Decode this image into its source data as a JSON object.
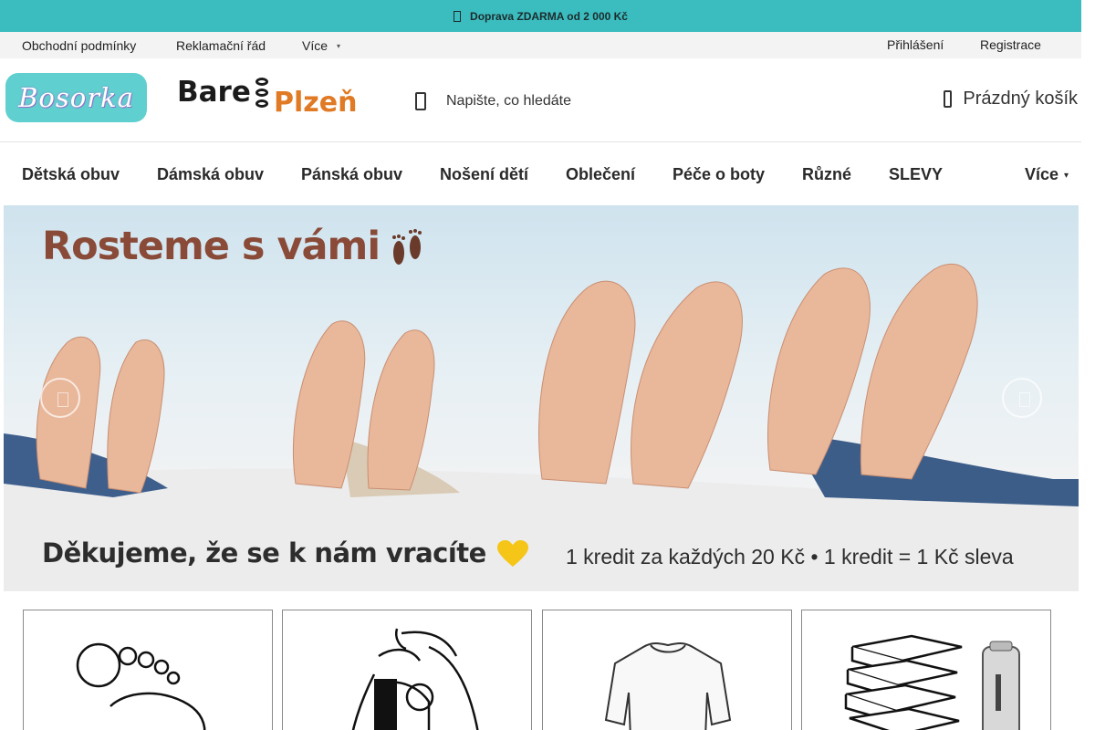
{
  "promo": {
    "text": "Doprava ZDARMA od 2 000 Kč",
    "icon": "truck-icon"
  },
  "top_nav": {
    "links": [
      "Obchodní podmínky",
      "Reklamační řád",
      "Více"
    ],
    "login": "Přihlášení",
    "register": "Registrace"
  },
  "header": {
    "logo_bosorka": "Bosorka",
    "logo_bare": "Bare",
    "logo_plzen": "Plzeň",
    "search_placeholder": "Napište, co hledáte",
    "cart_label": "Prázdný košík"
  },
  "main_nav": [
    "Dětská obuv",
    "Dámská obuv",
    "Pánská obuv",
    "Nošení dětí",
    "Oblečení",
    "Péče o boty",
    "Různé",
    "SLEVY",
    "Více"
  ],
  "hero": {
    "title": "Rosteme s vámi",
    "thanks": "Děkujeme, že se k nám vracíte",
    "credit": "1 kredit za každých 20 Kč • 1 kredit = 1 Kč sleva"
  },
  "categories": [
    {
      "icon": "footprint-icon"
    },
    {
      "icon": "baby-carrier-icon"
    },
    {
      "icon": "tshirt-icon"
    },
    {
      "icon": "books-bottle-icon"
    }
  ],
  "colors": {
    "promo_bg": "#3bbcbf",
    "topnav_bg": "#f3f3f3",
    "bosorka_bg": "#5fcfcf",
    "plzen_orange": "#e07a24",
    "hero_title": "#8a4a38",
    "heart": "#f5c518"
  }
}
